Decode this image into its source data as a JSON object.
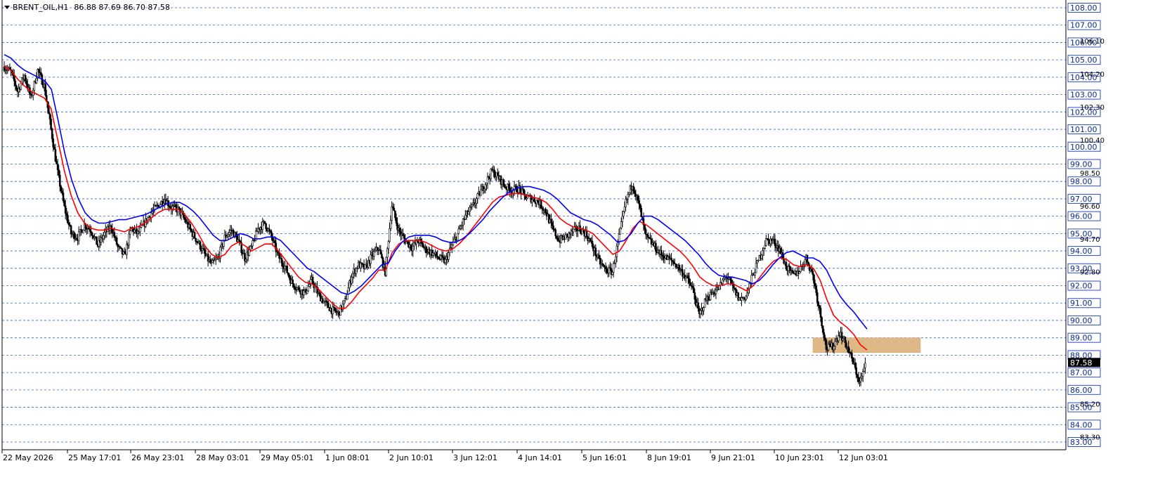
{
  "header": {
    "symbol": "BRENT_OIL,H1",
    "ohlc": "86.88 87.69 86.70 87.58"
  },
  "chart_data": {
    "type": "candlestick",
    "symbol": "BRENT_OIL",
    "timeframe": "H1",
    "ohlc_last": {
      "open": 86.88,
      "high": 87.69,
      "low": 86.7,
      "close": 87.58
    },
    "ylim": [
      83.0,
      108.0
    ],
    "grid": "horizontal dashed",
    "price_levels": [
      "108.00",
      "107.00",
      "106.00",
      "105.00",
      "104.00",
      "103.00",
      "102.00",
      "101.00",
      "100.00",
      "99.00",
      "98.00",
      "97.00",
      "96.00",
      "95.00",
      "94.00",
      "93.00",
      "92.00",
      "91.00",
      "90.00",
      "89.00",
      "88.00",
      "87.00",
      "86.00",
      "85.00",
      "84.00",
      "83.00"
    ],
    "minor_tick_labels": [
      "106.10",
      "104.20",
      "102.30",
      "100.40",
      "98.50",
      "96.60",
      "94.70",
      "92.80",
      "85.20",
      "83.30"
    ],
    "current_price_label": "87.58",
    "x_tick_labels": [
      "22 May 2026",
      "25 May 17:01",
      "26 May 23:01",
      "28 May 03:01",
      "29 May 05:01",
      "1 Jun 08:01",
      "2 Jun 10:01",
      "3 Jun 12:01",
      "4 Jun 14:01",
      "5 Jun 16:01",
      "8 Jun 19:01",
      "9 Jun 21:01",
      "10 Jun 23:01",
      "12 Jun 03:01"
    ],
    "price_path": [
      104.6,
      104.3,
      103.2,
      104.1,
      102.8,
      104.4,
      103.5,
      101.0,
      98.5,
      96.5,
      95.0,
      94.8,
      95.5,
      95.2,
      94.3,
      95.0,
      95.4,
      94.2,
      93.7,
      95.3,
      95.0,
      95.6,
      96.2,
      96.6,
      97.0,
      96.5,
      96.4,
      95.8,
      95.1,
      94.5,
      93.8,
      93.2,
      93.6,
      94.8,
      95.2,
      94.6,
      93.6,
      94.2,
      95.3,
      95.6,
      94.8,
      93.7,
      93.1,
      92.2,
      91.8,
      91.6,
      92.3,
      91.5,
      91.0,
      90.6,
      90.4,
      91.1,
      92.6,
      93.2,
      93.0,
      93.7,
      94.2,
      92.8,
      96.6,
      95.2,
      94.6,
      94.2,
      94.6,
      94.1,
      93.9,
      93.6,
      93.4,
      94.3,
      95.1,
      96.0,
      96.5,
      97.2,
      97.9,
      98.6,
      98.2,
      97.7,
      97.5,
      97.6,
      97.1,
      97.0,
      96.8,
      96.3,
      95.3,
      94.6,
      94.8,
      95.1,
      95.3,
      95.0,
      94.3,
      93.4,
      92.9,
      92.8,
      94.8,
      96.8,
      97.9,
      96.6,
      94.8,
      94.4,
      93.9,
      93.6,
      93.4,
      93.0,
      92.5,
      91.8,
      90.3,
      91.2,
      91.6,
      91.9,
      92.6,
      91.9,
      91.2,
      91.4,
      92.6,
      93.6,
      94.6,
      94.6,
      94.1,
      93.1,
      92.6,
      92.9,
      93.6,
      92.6,
      90.6,
      88.4,
      88.5,
      89.3,
      88.6,
      87.6,
      86.4,
      87.58
    ],
    "series": [
      {
        "name": "",
        "color": "#ff0000",
        "values": [
          104.6,
          104.4,
          103.9,
          103.5,
          103.2,
          103.0,
          102.8,
          102.2,
          100.4,
          98.6,
          97.2,
          96.2,
          95.6,
          95.3,
          95.2,
          95.2,
          95.3,
          95.2,
          95.1,
          95.3,
          95.4,
          95.6,
          95.9,
          96.2,
          96.4,
          96.4,
          96.4,
          96.1,
          95.6,
          95.0,
          94.3,
          93.8,
          93.6,
          93.8,
          94.3,
          94.5,
          94.3,
          94.0,
          94.2,
          94.4,
          94.4,
          94.0,
          93.5,
          93.0,
          92.5,
          92.2,
          92.1,
          91.8,
          91.4,
          91.0,
          90.7,
          90.7,
          91.1,
          91.6,
          92.0,
          92.4,
          92.9,
          92.9,
          93.9,
          94.4,
          94.6,
          94.6,
          94.6,
          94.5,
          94.3,
          94.1,
          94.0,
          94.1,
          94.4,
          94.8,
          95.3,
          95.8,
          96.3,
          96.8,
          97.1,
          97.2,
          97.3,
          97.3,
          97.2,
          97.1,
          97.0,
          96.8,
          96.4,
          95.9,
          95.6,
          95.4,
          95.3,
          95.2,
          95.0,
          94.6,
          94.2,
          93.8,
          94.0,
          94.6,
          95.3,
          95.7,
          95.5,
          95.2,
          94.9,
          94.6,
          94.3,
          94.0,
          93.6,
          93.1,
          92.5,
          92.2,
          92.0,
          92.0,
          92.1,
          92.1,
          91.9,
          91.7,
          92.0,
          92.5,
          93.0,
          93.4,
          93.6,
          93.5,
          93.2,
          93.1,
          93.2,
          93.0,
          92.3,
          91.2,
          90.3,
          89.9,
          89.6,
          89.2,
          88.6,
          88.3
        ]
      },
      {
        "name": "",
        "color": "#0000ff",
        "values": [
          105.3,
          105.1,
          104.7,
          104.4,
          104.2,
          104.0,
          103.8,
          103.3,
          101.5,
          99.6,
          98.1,
          97.0,
          96.2,
          95.8,
          95.6,
          95.6,
          95.7,
          95.8,
          95.8,
          95.9,
          96.0,
          96.1,
          96.3,
          96.5,
          96.7,
          96.8,
          96.8,
          96.6,
          96.3,
          95.9,
          95.4,
          94.9,
          94.6,
          94.6,
          94.8,
          95.0,
          94.9,
          94.7,
          94.7,
          94.8,
          94.8,
          94.6,
          94.2,
          93.8,
          93.4,
          93.0,
          92.8,
          92.5,
          92.2,
          91.9,
          91.6,
          91.5,
          91.7,
          92.0,
          92.4,
          92.8,
          93.2,
          93.3,
          94.0,
          94.5,
          94.8,
          94.9,
          94.9,
          94.9,
          94.8,
          94.6,
          94.5,
          94.5,
          94.7,
          95.0,
          95.4,
          95.8,
          96.3,
          96.7,
          97.1,
          97.4,
          97.6,
          97.7,
          97.7,
          97.6,
          97.5,
          97.3,
          97.0,
          96.6,
          96.2,
          96.0,
          95.8,
          95.7,
          95.5,
          95.2,
          94.9,
          94.5,
          94.6,
          95.0,
          95.6,
          96.0,
          96.0,
          95.8,
          95.5,
          95.2,
          94.9,
          94.6,
          94.2,
          93.8,
          93.3,
          92.9,
          92.6,
          92.5,
          92.5,
          92.4,
          92.3,
          92.1,
          92.3,
          92.7,
          93.2,
          93.6,
          93.9,
          94.0,
          93.8,
          93.6,
          93.6,
          93.4,
          92.9,
          92.1,
          91.4,
          90.9,
          90.5,
          90.0,
          89.5
        ]
      }
    ],
    "zone": {
      "price_from": 88.15,
      "price_to": 89.0,
      "color": "#deb887"
    }
  }
}
